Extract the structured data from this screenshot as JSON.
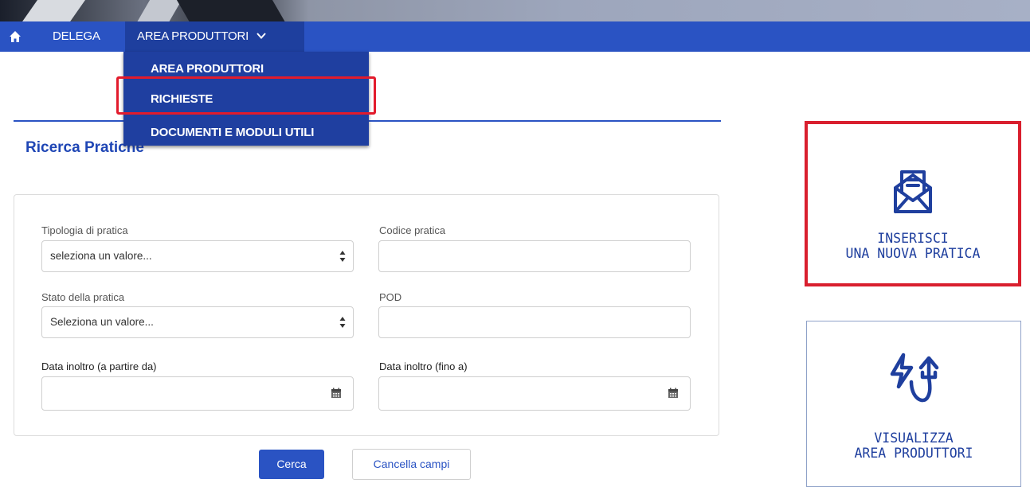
{
  "navbar": {
    "home_icon": "home-icon",
    "items": [
      {
        "label": "DELEGA"
      },
      {
        "label": "AREA PRODUTTORI"
      }
    ],
    "chevron_icon": "chevron-down-icon"
  },
  "dropdown": {
    "items": [
      {
        "label": "AREA PRODUTTORI"
      },
      {
        "label": "RICHIESTE"
      },
      {
        "label": "DOCUMENTI E MODULI UTILI"
      }
    ]
  },
  "section": {
    "title": "Ricerca Pratiche"
  },
  "form": {
    "tipologia": {
      "label": "Tipologia di pratica",
      "value": "seleziona un valore..."
    },
    "codice": {
      "label": "Codice pratica",
      "value": ""
    },
    "stato": {
      "label": "Stato della pratica",
      "value": "Seleziona un valore..."
    },
    "pod": {
      "label": "POD",
      "value": ""
    },
    "data_da": {
      "label": "Data inoltro (a partire da)",
      "value": ""
    },
    "data_a": {
      "label": "Data inoltro (fino a)",
      "value": ""
    }
  },
  "buttons": {
    "search_label": "Cerca",
    "clear_label": "Cancella campi"
  },
  "tiles": {
    "new_practice": {
      "line1": "INSERISCI",
      "line2": "UNA NUOVA PRATICA",
      "icon": "envelope-document-icon"
    },
    "producer_area": {
      "line1": "VISUALIZZA",
      "line2": "AREA PRODUTTORI",
      "icon": "energy-plug-icon"
    }
  },
  "colors": {
    "navbar": "#2a53c3",
    "dropdown": "#1f3fa0",
    "highlight": "#e21b2c",
    "accent_text": "#1f46b5"
  }
}
